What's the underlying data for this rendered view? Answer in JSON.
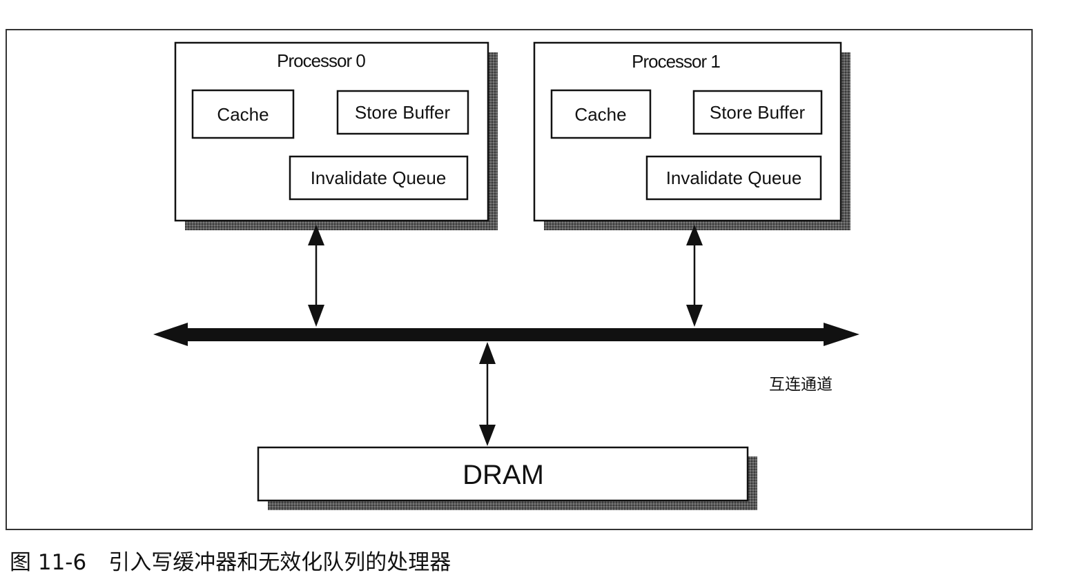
{
  "processors": [
    {
      "title": "Processor 0",
      "cache": "Cache",
      "store_buffer": "Store Buffer",
      "invalidate_queue": "Invalidate Queue"
    },
    {
      "title": "Processor 1",
      "cache": "Cache",
      "store_buffer": "Store Buffer",
      "invalidate_queue": "Invalidate Queue"
    }
  ],
  "bus_label": "互连通道",
  "memory_label": "DRAM",
  "caption": {
    "number": "图 11-6",
    "text": "引入写缓冲器和无效化队列的处理器"
  }
}
